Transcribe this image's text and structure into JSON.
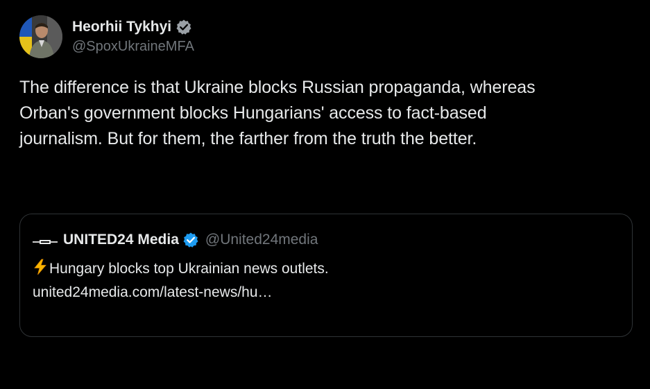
{
  "author": {
    "display_name": "Heorhii Tykhyi",
    "handle": "@SpoxUkraineMFA",
    "avatar_icon": "profile-photo-icon",
    "verified_icon": "verified-badge-icon",
    "verified_color": "#9aa0a6"
  },
  "tweet": {
    "text": "The difference is that Ukraine blocks Russian propaganda, whereas\nOrban's government blocks Hungarians' access to fact-based\njournalism. But for them, the farther from the truth the better."
  },
  "quote": {
    "display_name": "UNITED24 Media",
    "handle": "@United24media",
    "verified_icon": "verified-badge-icon",
    "verified_color": "#1d9bf0",
    "logo_icon": "united24-logo-icon",
    "bolt_icon": "lightning-bolt-icon",
    "text": "Hungary blocks top Ukrainian news outlets.",
    "link": "united24media.com/latest-news/hu…"
  },
  "colors": {
    "background": "#000000",
    "text": "#e7e9ea",
    "secondary": "#71767b",
    "border": "#2f3336"
  }
}
